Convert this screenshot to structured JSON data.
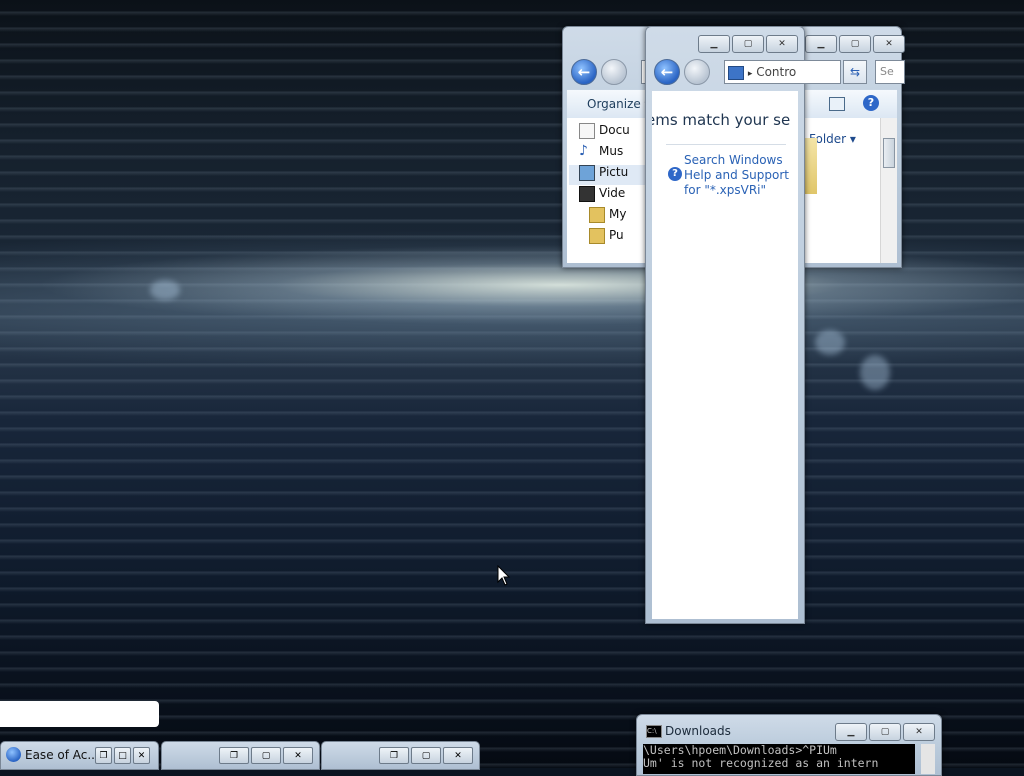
{
  "explorer": {
    "organize_label": "Organize",
    "search_placeholder": "Se",
    "nav_items": [
      "Docu",
      "Mus",
      "Pictu",
      "Vide",
      "My",
      "Pu"
    ],
    "folder_label": "Folder"
  },
  "search_window": {
    "address_text": "Contro",
    "no_results_text": "ems match your se",
    "help_link_text": "Search Windows Help and Support for \"*.xpsVRi\""
  },
  "cmd_window": {
    "title": "Downloads",
    "line1": "\\Users\\hpoem\\Downloads>^PIUm",
    "line2": "Um' is not recognized as an intern"
  },
  "minimized": {
    "ease_title": "Ease of Ac..."
  }
}
